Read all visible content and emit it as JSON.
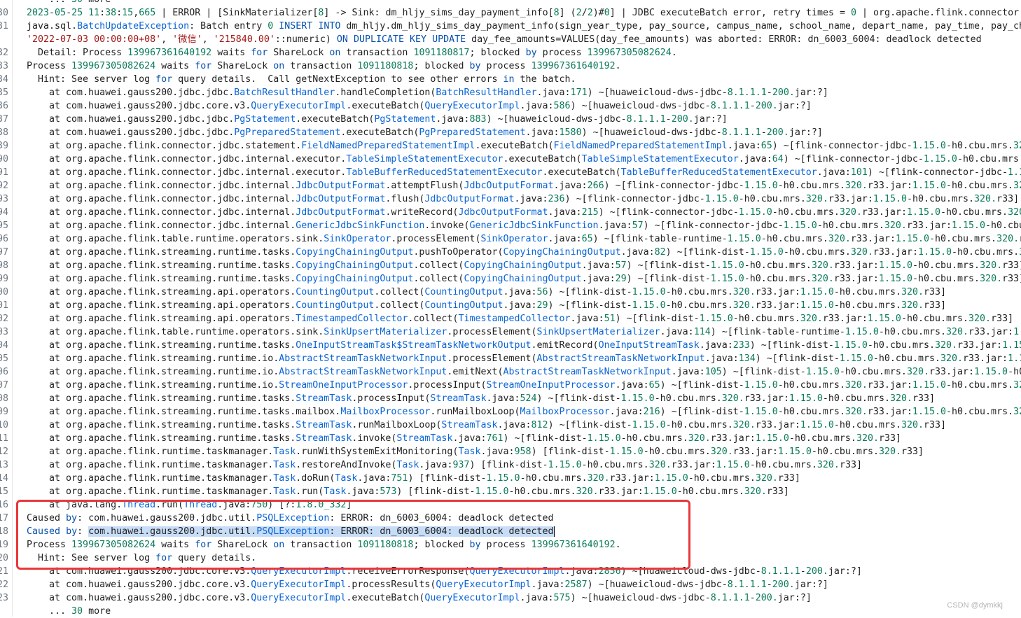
{
  "editor": {
    "lines": [
      {
        "n": "",
        "t": "    ... 30 more"
      },
      {
        "n": "30",
        "t": "2023-05-25 11:38:15,665 | ERROR | [SinkMaterializer[8] -> Sink: dm_hljy_sims_day_payment_info[8] (2/2)#0] | JDBC executeBatch error, retry times = 0 | org.apache.flink.connector.jdbc.in"
      },
      {
        "n": "31",
        "t": "java.sql.BatchUpdateException: Batch entry 0 INSERT INTO dm_hljy.dm_hljy_sims_day_payment_info(sign_year_type, pay_source, campus_name, school_name, depart_name, pay_time, pay_channel_"
      },
      {
        "n": "",
        "t": "'2022-07-03 00:00:00+08', '微信', '215840.00'::numeric) ON DUPLICATE KEY UPDATE day_fee_amounts=VALUES(day_fee_amounts) was aborted: ERROR: dn_6003_6004: deadlock detected"
      },
      {
        "n": "32",
        "t": "  Detail: Process 139967361640192 waits for ShareLock on transaction 1091180817; blocked by process 139967305082624."
      },
      {
        "n": "33",
        "t": "Process 139967305082624 waits for ShareLock on transaction 1091180818; blocked by process 139967361640192."
      },
      {
        "n": "34",
        "t": "  Hint: See server log for query details.  Call getNextException to see other errors in the batch."
      },
      {
        "n": "35",
        "t": "    at com.huawei.gauss200.jdbc.jdbc.BatchResultHandler.handleCompletion(BatchResultHandler.java:171) ~[huaweicloud-dws-jdbc-8.1.1.1-200.jar:?]"
      },
      {
        "n": "36",
        "t": "    at com.huawei.gauss200.jdbc.core.v3.QueryExecutorImpl.executeBatch(QueryExecutorImpl.java:586) ~[huaweicloud-dws-jdbc-8.1.1.1-200.jar:?]"
      },
      {
        "n": "37",
        "t": "    at com.huawei.gauss200.jdbc.jdbc.PgStatement.executeBatch(PgStatement.java:883) ~[huaweicloud-dws-jdbc-8.1.1.1-200.jar:?]"
      },
      {
        "n": "38",
        "t": "    at com.huawei.gauss200.jdbc.jdbc.PgPreparedStatement.executeBatch(PgPreparedStatement.java:1580) ~[huaweicloud-dws-jdbc-8.1.1.1-200.jar:?]"
      },
      {
        "n": "39",
        "t": "    at org.apache.flink.connector.jdbc.statement.FieldNamedPreparedStatementImpl.executeBatch(FieldNamedPreparedStatementImpl.java:65) ~[flink-connector-jdbc-1.15.0-h0.cbu.mrs.320.r33.ja"
      },
      {
        "n": "90",
        "t": "    at org.apache.flink.connector.jdbc.internal.executor.TableSimpleStatementExecutor.executeBatch(TableSimpleStatementExecutor.java:64) ~[flink-connector-jdbc-1.15.0-h0.cbu.mrs.320.r33"
      },
      {
        "n": "91",
        "t": "    at org.apache.flink.connector.jdbc.internal.executor.TableBufferReducedStatementExecutor.executeBatch(TableBufferReducedStatementExecutor.java:101) ~[flink-connector-jdbc-1.15.0-h0."
      },
      {
        "n": "92",
        "t": "    at org.apache.flink.connector.jdbc.internal.JdbcOutputFormat.attemptFlush(JdbcOutputFormat.java:266) ~[flink-connector-jdbc-1.15.0-h0.cbu.mrs.320.r33.jar:1.15.0-h0.cbu.mrs.320.r33]"
      },
      {
        "n": "93",
        "t": "    at org.apache.flink.connector.jdbc.internal.JdbcOutputFormat.flush(JdbcOutputFormat.java:236) ~[flink-connector-jdbc-1.15.0-h0.cbu.mrs.320.r33.jar:1.15.0-h0.cbu.mrs.320.r33]"
      },
      {
        "n": "94",
        "t": "    at org.apache.flink.connector.jdbc.internal.JdbcOutputFormat.writeRecord(JdbcOutputFormat.java:215) ~[flink-connector-jdbc-1.15.0-h0.cbu.mrs.320.r33.jar:1.15.0-h0.cbu.mrs.320.r33]"
      },
      {
        "n": "95",
        "t": "    at org.apache.flink.connector.jdbc.internal.GenericJdbcSinkFunction.invoke(GenericJdbcSinkFunction.java:57) ~[flink-connector-jdbc-1.15.0-h0.cbu.mrs.320.r33.jar:1.15.0-h0.cbu.mrs.32"
      },
      {
        "n": "96",
        "t": "    at org.apache.flink.table.runtime.operators.sink.SinkOperator.processElement(SinkOperator.java:65) ~[flink-table-runtime-1.15.0-h0.cbu.mrs.320.r33.jar:1.15.0-h0.cbu.mrs.320.r33]"
      },
      {
        "n": "97",
        "t": "    at org.apache.flink.streaming.runtime.tasks.CopyingChainingOutput.pushToOperator(CopyingChainingOutput.java:82) ~[flink-dist-1.15.0-h0.cbu.mrs.320.r33.jar:1.15.0-h0.cbu.mrs.320.r33]"
      },
      {
        "n": "98",
        "t": "    at org.apache.flink.streaming.runtime.tasks.CopyingChainingOutput.collect(CopyingChainingOutput.java:57) ~[flink-dist-1.15.0-h0.cbu.mrs.320.r33.jar:1.15.0-h0.cbu.mrs.320.r33]"
      },
      {
        "n": "99",
        "t": "    at org.apache.flink.streaming.runtime.tasks.CopyingChainingOutput.collect(CopyingChainingOutput.java:29) ~[flink-dist-1.15.0-h0.cbu.mrs.320.r33.jar:1.15.0-h0.cbu.mrs.320.r33]"
      },
      {
        "n": "00",
        "t": "    at org.apache.flink.streaming.api.operators.CountingOutput.collect(CountingOutput.java:56) ~[flink-dist-1.15.0-h0.cbu.mrs.320.r33.jar:1.15.0-h0.cbu.mrs.320.r33]"
      },
      {
        "n": "01",
        "t": "    at org.apache.flink.streaming.api.operators.CountingOutput.collect(CountingOutput.java:29) ~[flink-dist-1.15.0-h0.cbu.mrs.320.r33.jar:1.15.0-h0.cbu.mrs.320.r33]"
      },
      {
        "n": "02",
        "t": "    at org.apache.flink.streaming.api.operators.TimestampedCollector.collect(TimestampedCollector.java:51) ~[flink-dist-1.15.0-h0.cbu.mrs.320.r33.jar:1.15.0-h0.cbu.mrs.320.r33]"
      },
      {
        "n": "03",
        "t": "    at org.apache.flink.table.runtime.operators.sink.SinkUpsertMaterializer.processElement(SinkUpsertMaterializer.java:114) ~[flink-table-runtime-1.15.0-h0.cbu.mrs.320.r33.jar:1.15.0-h"
      },
      {
        "n": "04",
        "t": "    at org.apache.flink.streaming.runtime.tasks.OneInputStreamTask$StreamTaskNetworkOutput.emitRecord(OneInputStreamTask.java:233) ~[flink-dist-1.15.0-h0.cbu.mrs.320.r33.jar:1.15.0-h0."
      },
      {
        "n": "05",
        "t": "    at org.apache.flink.streaming.runtime.io.AbstractStreamTaskNetworkInput.processElement(AbstractStreamTaskNetworkInput.java:134) ~[flink-dist-1.15.0-h0.cbu.mrs.320.r33.jar:1.15.0-h"
      },
      {
        "n": "06",
        "t": "    at org.apache.flink.streaming.runtime.io.AbstractStreamTaskNetworkInput.emitNext(AbstractStreamTaskNetworkInput.java:105) ~[flink-dist-1.15.0-h0.cbu.mrs.320.r33.jar:1.15.0-h0.cbu.m"
      },
      {
        "n": "07",
        "t": "    at org.apache.flink.streaming.runtime.io.StreamOneInputProcessor.processInput(StreamOneInputProcessor.java:65) ~[flink-dist-1.15.0-h0.cbu.mrs.320.r33.jar:1.15.0-h0.cbu.mrs.320.r33]"
      },
      {
        "n": "08",
        "t": "    at org.apache.flink.streaming.runtime.tasks.StreamTask.processInput(StreamTask.java:524) ~[flink-dist-1.15.0-h0.cbu.mrs.320.r33.jar:1.15.0-h0.cbu.mrs.320.r33]"
      },
      {
        "n": "09",
        "t": "    at org.apache.flink.streaming.runtime.tasks.mailbox.MailboxProcessor.runMailboxLoop(MailboxProcessor.java:216) ~[flink-dist-1.15.0-h0.cbu.mrs.320.r33.jar:1.15.0-h0.cbu.mrs.320.r33]"
      },
      {
        "n": "10",
        "t": "    at org.apache.flink.streaming.runtime.tasks.StreamTask.runMailboxLoop(StreamTask.java:812) ~[flink-dist-1.15.0-h0.cbu.mrs.320.r33.jar:1.15.0-h0.cbu.mrs.320.r33]"
      },
      {
        "n": "11",
        "t": "    at org.apache.flink.streaming.runtime.tasks.StreamTask.invoke(StreamTask.java:761) ~[flink-dist-1.15.0-h0.cbu.mrs.320.r33.jar:1.15.0-h0.cbu.mrs.320.r33]"
      },
      {
        "n": "12",
        "t": "    at org.apache.flink.runtime.taskmanager.Task.runWithSystemExitMonitoring(Task.java:958) [flink-dist-1.15.0-h0.cbu.mrs.320.r33.jar:1.15.0-h0.cbu.mrs.320.r33]"
      },
      {
        "n": "13",
        "t": "    at org.apache.flink.runtime.taskmanager.Task.restoreAndInvoke(Task.java:937) [flink-dist-1.15.0-h0.cbu.mrs.320.r33.jar:1.15.0-h0.cbu.mrs.320.r33]"
      },
      {
        "n": "14",
        "t": "    at org.apache.flink.runtime.taskmanager.Task.doRun(Task.java:751) [flink-dist-1.15.0-h0.cbu.mrs.320.r33.jar:1.15.0-h0.cbu.mrs.320.r33]"
      },
      {
        "n": "15",
        "t": "    at org.apache.flink.runtime.taskmanager.Task.run(Task.java:573) [flink-dist-1.15.0-h0.cbu.mrs.320.r33.jar:1.15.0-h0.cbu.mrs.320.r33]"
      },
      {
        "n": "16",
        "t": "    at java.lang.Thread.run(Thread.java:750) [?:1.8.0_332]"
      },
      {
        "n": "17",
        "t": "Caused by: com.huawei.gauss200.jdbc.util.PSQLException: ERROR: dn_6003_6004: deadlock detected"
      },
      {
        "n": "18",
        "t": "  Detail: Process 139967361640192 waits for ShareLock on transaction 1091180817; blocked by process 139967305082624."
      },
      {
        "n": "19",
        "t": "Process 139967305082624 waits for ShareLock on transaction 1091180818; blocked by process 139967361640192."
      },
      {
        "n": "20",
        "t": "  Hint: See server log for query details."
      },
      {
        "n": "21",
        "t": "    at com.huawei.gauss200.jdbc.core.v3.QueryExecutorImpl.receiveErrorResponse(QueryExecutorImpl.java:2856) ~[huaweicloud-dws-jdbc-8.1.1.1-200.jar:?]"
      },
      {
        "n": "22",
        "t": "    at com.huawei.gauss200.jdbc.core.v3.QueryExecutorImpl.processResults(QueryExecutorImpl.java:2587) ~[huaweicloud-dws-jdbc-8.1.1.1-200.jar:?]"
      },
      {
        "n": "23",
        "t": "    at com.huawei.gauss200.jdbc.core.v3.QueryExecutorImpl.executeBatch(QueryExecutorImpl.java:575) ~[huaweicloud-dws-jdbc-8.1.1.1-200.jar:?]"
      },
      {
        "n": "",
        "t": "    ... 30 more"
      }
    ],
    "selected_text": "com.huawei.gauss200.jdbc.util.PSQLException: ERROR: dn_6003_6004: deadlock detected",
    "selected_line_index": 40
  },
  "watermark": "CSDN @dymkkj",
  "colors": {
    "highlight_box": "#e8373b",
    "selection": "#c7ddf7",
    "keyword": "#0550ae",
    "class_ref": "#0a64d6",
    "string": "#a31515",
    "number": "#0b7a5a"
  }
}
